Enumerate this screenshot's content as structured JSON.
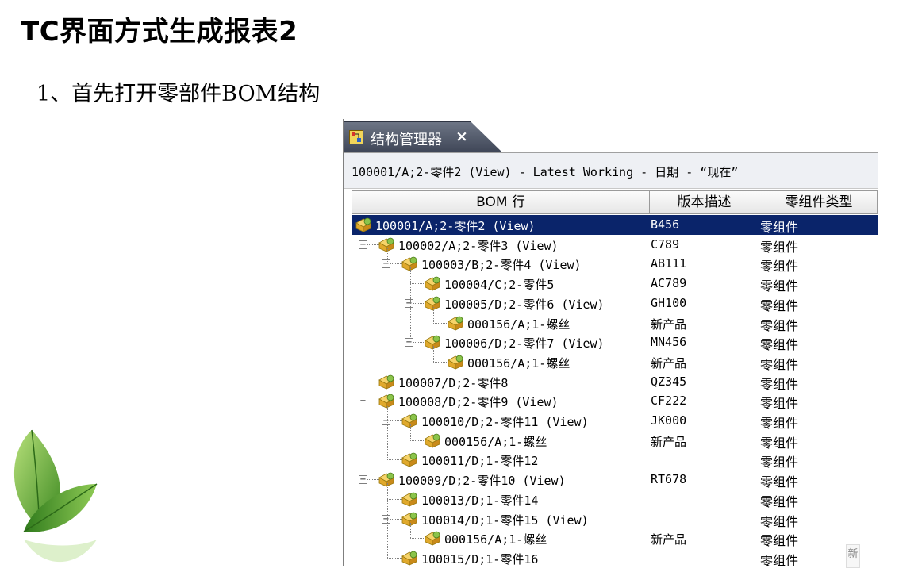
{
  "slide": {
    "title": "TC界面方式生成报表2",
    "step": "1、首先打开零部件BOM结构"
  },
  "window": {
    "tab_label": "结构管理器",
    "tab_close": "×",
    "context": "100001/A;2-零件2 (View) - Latest Working - 日期 - “现在”",
    "columns": {
      "bom": "BOM 行",
      "version": "版本描述",
      "type": "零组件类型"
    },
    "rows": [
      {
        "name": "100001/A;2-零件2 (View)",
        "version": "B456",
        "type": "零组件",
        "level": 0,
        "expander": "",
        "selected": true
      },
      {
        "name": "100002/A;2-零件3 (View)",
        "version": "C789",
        "type": "零组件",
        "level": 1,
        "expander": "−"
      },
      {
        "name": "100003/B;2-零件4 (View)",
        "version": "AB111",
        "type": "零组件",
        "level": 2,
        "expander": "−"
      },
      {
        "name": "100004/C;2-零件5",
        "version": "AC789",
        "type": "零组件",
        "level": 3,
        "expander": ""
      },
      {
        "name": "100005/D;2-零件6 (View)",
        "version": "GH100",
        "type": "零组件",
        "level": 3,
        "expander": "−"
      },
      {
        "name": "000156/A;1-螺丝",
        "version": "新产品",
        "type": "零组件",
        "level": 4,
        "expander": ""
      },
      {
        "name": "100006/D;2-零件7 (View)",
        "version": "MN456",
        "type": "零组件",
        "level": 3,
        "expander": "−"
      },
      {
        "name": "000156/A;1-螺丝",
        "version": "新产品",
        "type": "零组件",
        "level": 4,
        "expander": ""
      },
      {
        "name": "100007/D;2-零件8",
        "version": "QZ345",
        "type": "零组件",
        "level": 1,
        "expander": ""
      },
      {
        "name": "100008/D;2-零件9 (View)",
        "version": "CF222",
        "type": "零组件",
        "level": 1,
        "expander": "−"
      },
      {
        "name": "100010/D;2-零件11 (View)",
        "version": "JK000",
        "type": "零组件",
        "level": 2,
        "expander": "−"
      },
      {
        "name": "000156/A;1-螺丝",
        "version": "新产品",
        "type": "零组件",
        "level": 3,
        "expander": ""
      },
      {
        "name": "100011/D;1-零件12",
        "version": "",
        "type": "零组件",
        "level": 2,
        "expander": ""
      },
      {
        "name": "100009/D;2-零件10 (View)",
        "version": "RT678",
        "type": "零组件",
        "level": 1,
        "expander": "−"
      },
      {
        "name": "100013/D;1-零件14",
        "version": "",
        "type": "零组件",
        "level": 2,
        "expander": ""
      },
      {
        "name": "100014/D;1-零件15 (View)",
        "version": "",
        "type": "零组件",
        "level": 2,
        "expander": "−"
      },
      {
        "name": "000156/A;1-螺丝",
        "version": "新产品",
        "type": "零组件",
        "level": 3,
        "expander": ""
      },
      {
        "name": "100015/D;1-零件16",
        "version": "",
        "type": "零组件",
        "level": 2,
        "expander": ""
      }
    ]
  },
  "corner_note": "新",
  "colors": {
    "selection": "#0a246a",
    "tab_bg": "#4a5263"
  },
  "icons": {
    "node": "bom-part-icon",
    "tab": "structure-manager-icon"
  }
}
